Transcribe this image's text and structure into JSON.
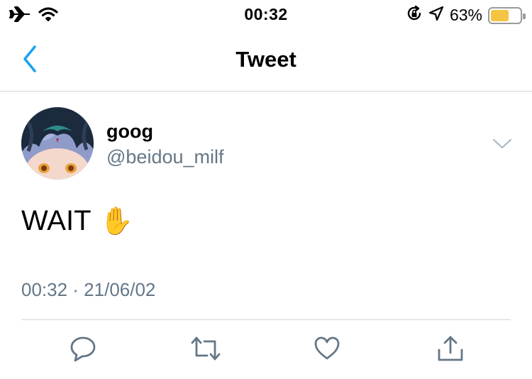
{
  "status_bar": {
    "time": "00:32",
    "battery_percent": "63%",
    "battery_level": 0.63,
    "icons": [
      "airplane-icon",
      "wifi-icon",
      "rotation-lock-icon",
      "location-icon",
      "battery-icon"
    ]
  },
  "nav": {
    "title": "Tweet",
    "back_icon": "chevron-left-icon"
  },
  "tweet": {
    "display_name": "goog",
    "handle": "@beidou_milf",
    "text": "WAIT",
    "emoji": "✋",
    "timestamp": "00:32 · 21/06/02"
  },
  "actions": [
    "reply-icon",
    "retweet-icon",
    "like-icon",
    "share-icon"
  ],
  "colors": {
    "accent": "#1da1f2",
    "secondary_text": "#657786",
    "divider": "#d2d6d9",
    "icon_gray": "#657786",
    "battery": "#f6c443"
  }
}
